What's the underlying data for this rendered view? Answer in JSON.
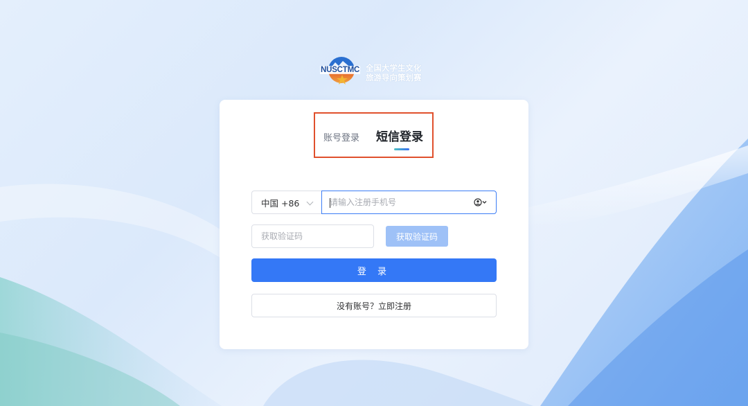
{
  "logo": {
    "abbr": "NUSCTMC",
    "line1": "全国大学生文化",
    "line2": "旅游导向策划赛"
  },
  "tabs": {
    "account_label": "账号登录",
    "sms_label": "短信登录",
    "active": "sms"
  },
  "phone": {
    "country_code": "中国 +86",
    "placeholder": "请输入注册手机号"
  },
  "verify": {
    "placeholder": "获取验证码",
    "get_code_label": "获取验证码"
  },
  "login_label": "登 录",
  "register_label": "没有账号？立即注册",
  "colors": {
    "primary": "#3478f6",
    "primary_disabled": "#9ec1f7",
    "highlight_box": "#e0502c"
  }
}
